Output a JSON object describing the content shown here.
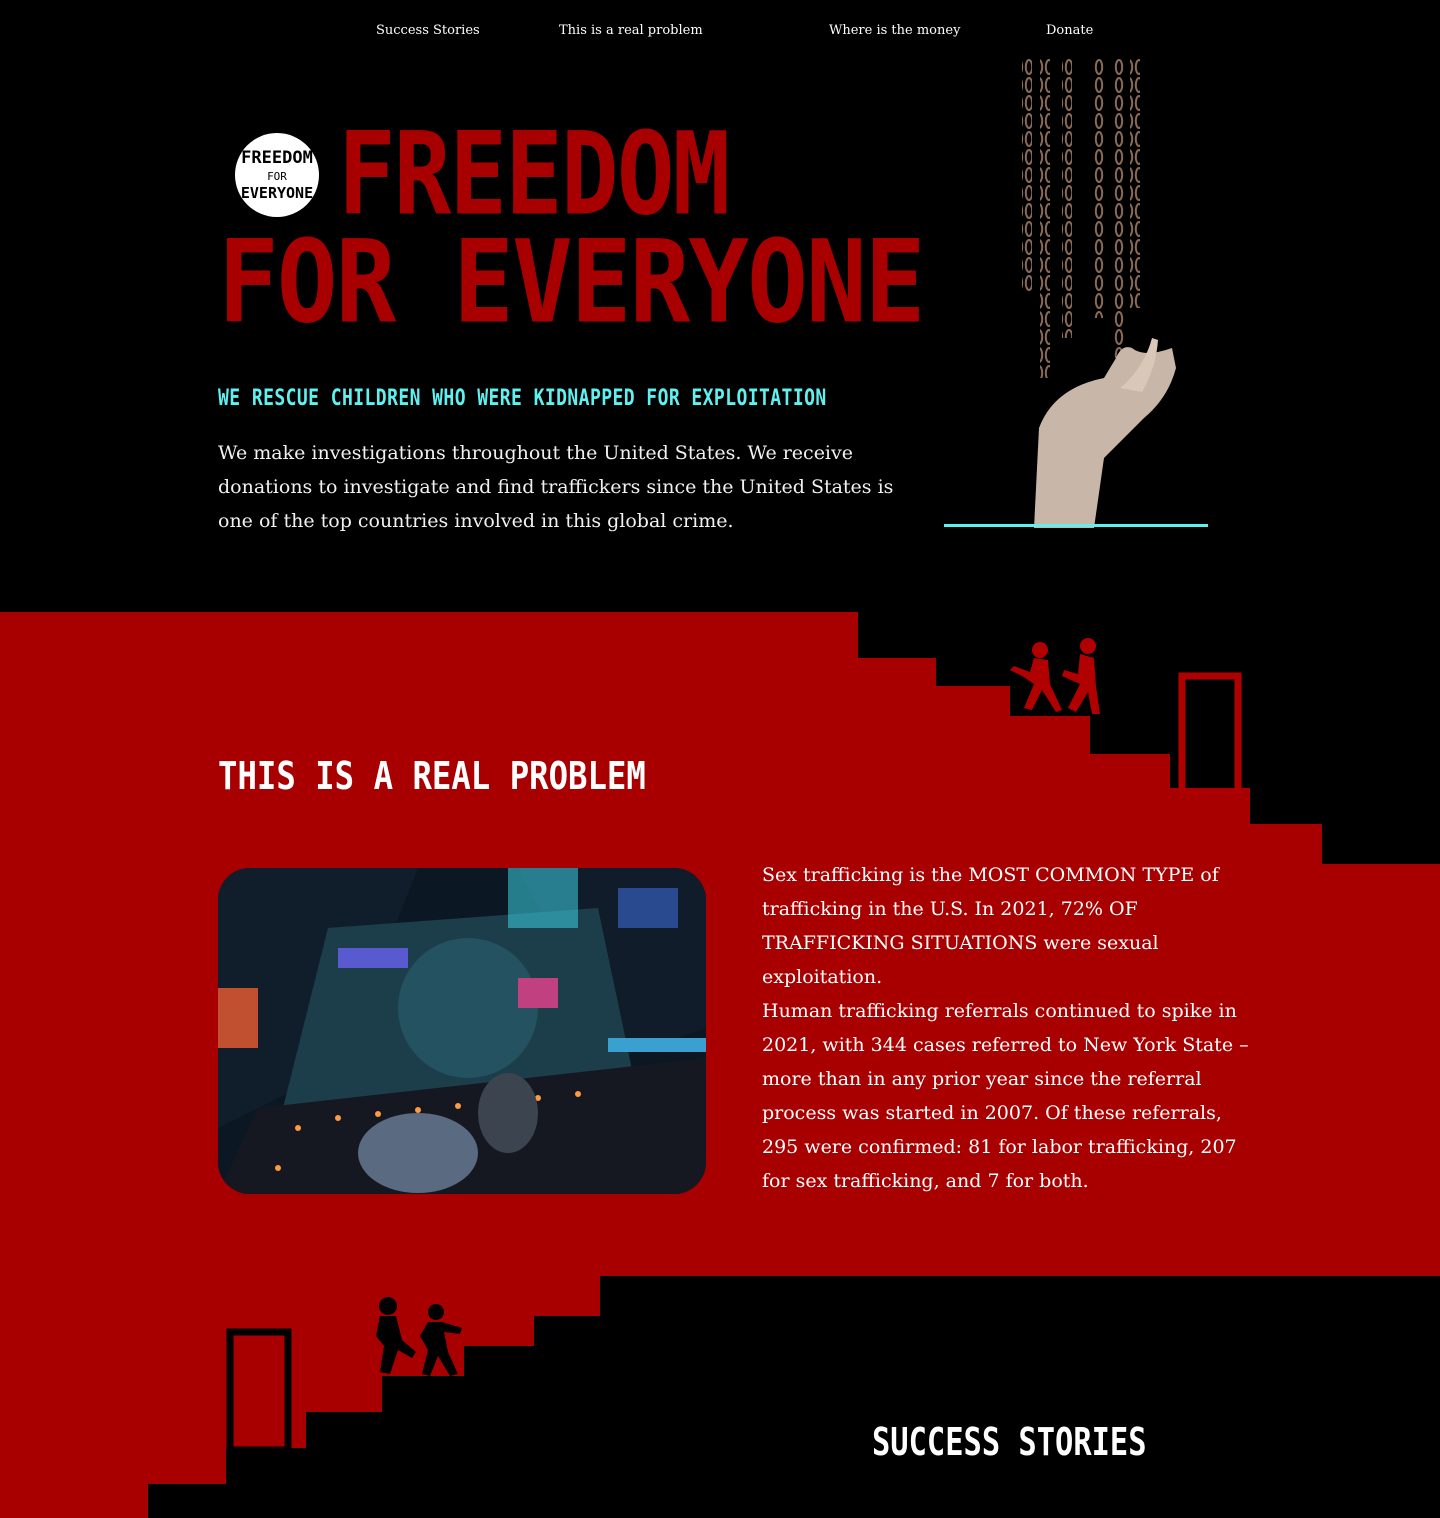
{
  "nav": {
    "items": [
      {
        "label": "Success Stories"
      },
      {
        "label": "This is a real problem"
      },
      {
        "label": "Where is the money"
      },
      {
        "label": "Donate"
      }
    ]
  },
  "hero": {
    "logo_text": [
      "FREEDOM",
      "FOR",
      "EVERYONE"
    ],
    "title_line1": "FREEDOM",
    "title_line2": "FOR EVERYONE",
    "subtitle": "WE RESCUE CHILDREN WHO WERE KIDNAPPED FOR EXPLOITATION",
    "body": "We make investigations throughout the United States. We receive donations to investigate and find traffickers since the United States is one of the top countries involved in this global crime."
  },
  "problem": {
    "title": "THIS IS A REAL PROBLEM",
    "paragraph1": "Sex trafficking is the MOST COMMON TYPE of trafficking in the U.S. In 2021, 72% OF TRAFFICKING SITUATIONS were sexual exploitation.",
    "paragraph2": "Human trafficking referrals continued to spike in 2021, with 344 cases referred to New York State –more than in any prior year since the referral process was started in 2007. Of these referrals, 295 were confirmed: 81 for labor trafficking, 207 for sex trafficking, and 7 for both."
  },
  "success": {
    "title": "SUCCESS STORIES"
  },
  "colors": {
    "red": "#a80000",
    "cyan": "#5ff0f0",
    "black": "#000000",
    "white": "#ffffff"
  },
  "icons": [
    "logo-badge-icon",
    "chains-hand-image",
    "children-running-icon",
    "door-icon",
    "city-aerial-image"
  ]
}
